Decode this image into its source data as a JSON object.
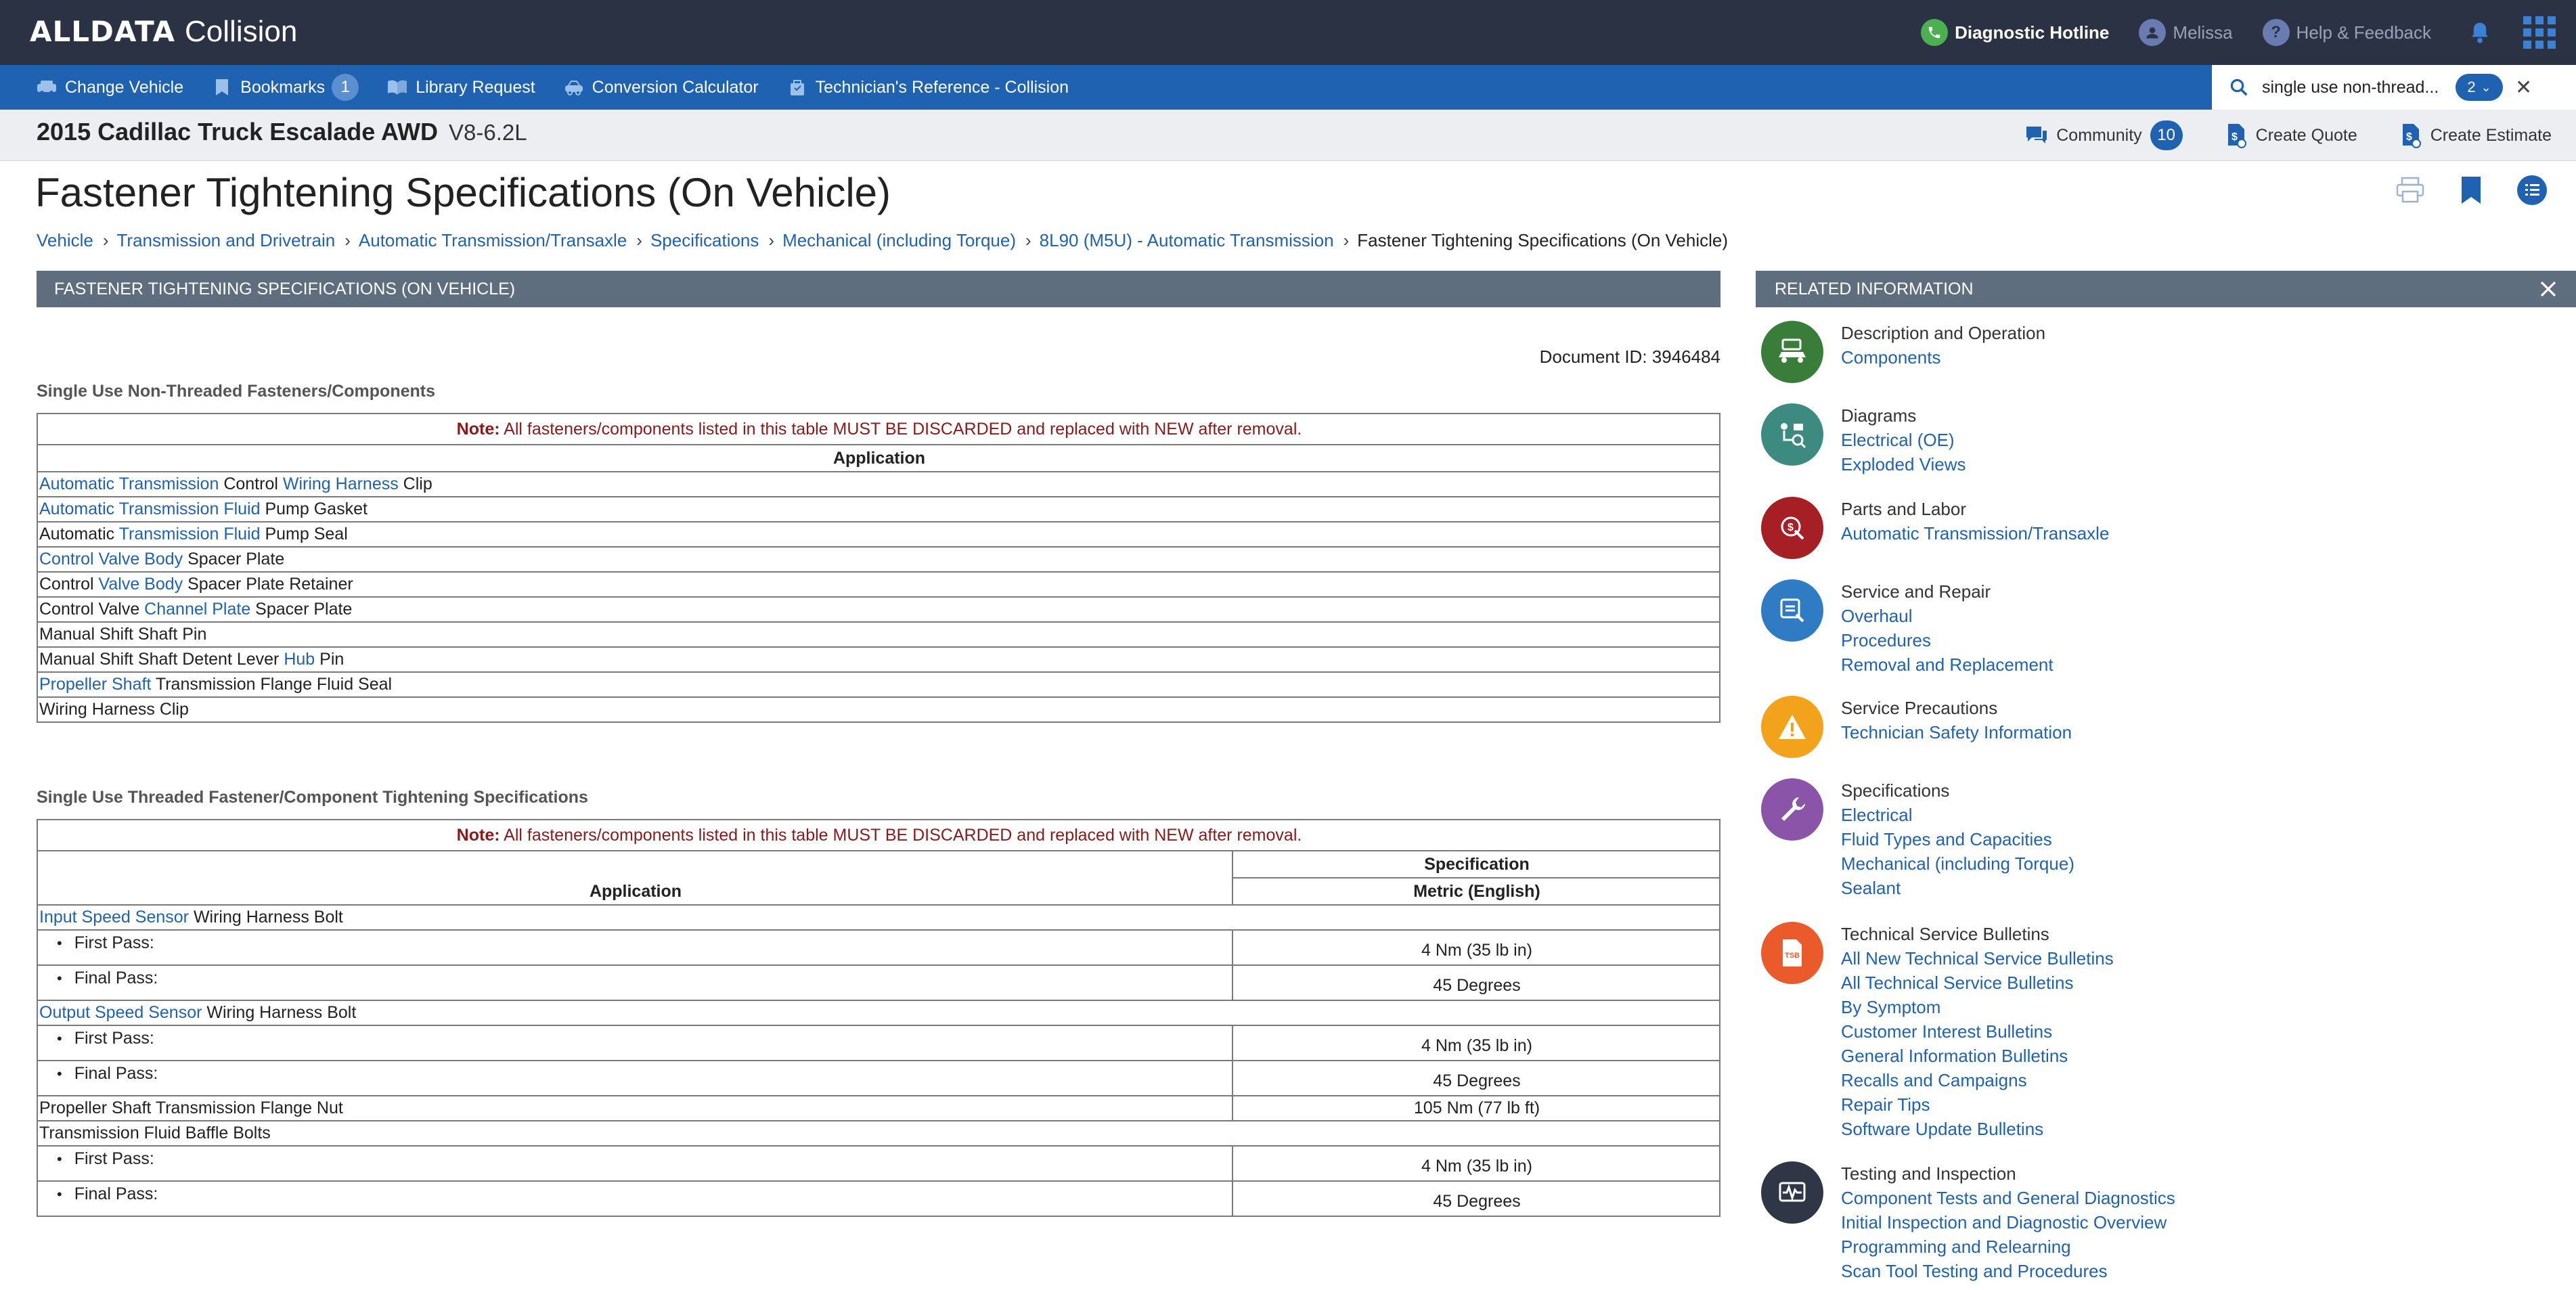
{
  "header": {
    "brand": "ALLDATA",
    "product": "Collision",
    "hotline_label": "Diagnostic Hotline",
    "user_name": "Melissa",
    "help_label": "Help & Feedback"
  },
  "nav": {
    "items": [
      {
        "label": "Change Vehicle",
        "icon": "car-icon"
      },
      {
        "label": "Bookmarks",
        "icon": "bookmark-icon",
        "badge": "1"
      },
      {
        "label": "Library Request",
        "icon": "book-icon"
      },
      {
        "label": "Conversion Calculator",
        "icon": "calculator-icon"
      },
      {
        "label": "Technician's Reference - Collision",
        "icon": "reference-icon"
      }
    ],
    "search": {
      "value": "single use non-thread...",
      "hit_count": "2"
    }
  },
  "vehicle": {
    "name": "2015 Cadillac Truck Escalade AWD",
    "engine": "V8-6.2L",
    "community_label": "Community",
    "community_count": "10",
    "quote_label": "Create Quote",
    "estimate_label": "Create Estimate"
  },
  "page": {
    "title": "Fastener Tightening Specifications (On Vehicle)",
    "breadcrumb": [
      "Vehicle",
      "Transmission and Drivetrain",
      "Automatic Transmission/Transaxle",
      "Specifications",
      "Mechanical (including Torque)",
      "8L90 (M5U) - Automatic Transmission",
      "Fastener Tightening Specifications (On Vehicle)"
    ]
  },
  "document": {
    "header": "FASTENER TIGHTENING SPECIFICATIONS (ON VEHICLE)",
    "doc_id": "Document ID: 3946484",
    "note_label": "Note:",
    "note_text": "All fasteners/components listed in this table MUST BE DISCARDED and replaced with NEW after removal.",
    "table1": {
      "title": "Single Use Non-Threaded Fasteners/Components",
      "column": "Application",
      "rows": [
        [
          {
            "t": "Automatic Transmission",
            "link": true
          },
          {
            "t": " Control "
          },
          {
            "t": "Wiring Harness",
            "link": true
          },
          {
            "t": " Clip"
          }
        ],
        [
          {
            "t": "Automatic Transmission Fluid",
            "link": true
          },
          {
            "t": " Pump Gasket"
          }
        ],
        [
          {
            "t": "Automatic "
          },
          {
            "t": "Transmission Fluid",
            "link": true
          },
          {
            "t": " Pump Seal"
          }
        ],
        [
          {
            "t": "Control Valve Body",
            "link": true
          },
          {
            "t": " Spacer Plate"
          }
        ],
        [
          {
            "t": "Control "
          },
          {
            "t": "Valve Body",
            "link": true
          },
          {
            "t": " Spacer Plate Retainer"
          }
        ],
        [
          {
            "t": "Control Valve "
          },
          {
            "t": "Channel Plate",
            "link": true
          },
          {
            "t": " Spacer Plate"
          }
        ],
        [
          {
            "t": "Manual Shift Shaft Pin"
          }
        ],
        [
          {
            "t": "Manual Shift Shaft Detent Lever "
          },
          {
            "t": "Hub",
            "link": true
          },
          {
            "t": " Pin"
          }
        ],
        [
          {
            "t": "Propeller Shaft",
            "link": true
          },
          {
            "t": " Transmission Flange Fluid Seal"
          }
        ],
        [
          {
            "t": "Wiring Harness Clip"
          }
        ]
      ]
    },
    "table2": {
      "title": "Single Use Threaded Fastener/Component Tightening Specifications",
      "col_application": "Application",
      "col_specification": "Specification",
      "col_units": "Metric (English)",
      "rows": [
        {
          "kind": "group",
          "parts": [
            {
              "t": "Input Speed Sensor",
              "link": true
            },
            {
              "t": " Wiring Harness Bolt"
            }
          ]
        },
        {
          "kind": "pass",
          "label": "First Pass:",
          "value": "4 Nm (35 lb in)"
        },
        {
          "kind": "pass",
          "label": "Final Pass:",
          "value": "45 Degrees"
        },
        {
          "kind": "group",
          "parts": [
            {
              "t": "Output Speed Sensor",
              "link": true
            },
            {
              "t": " Wiring Harness Bolt"
            }
          ]
        },
        {
          "kind": "pass",
          "label": "First Pass:",
          "value": "4 Nm (35 lb in)"
        },
        {
          "kind": "pass",
          "label": "Final Pass:",
          "value": "45 Degrees"
        },
        {
          "kind": "single",
          "parts": [
            {
              "t": "Propeller Shaft Transmission Flange Nut"
            }
          ],
          "value": "105 Nm (77 lb ft)"
        },
        {
          "kind": "group",
          "parts": [
            {
              "t": "Transmission Fluid Baffle Bolts"
            }
          ]
        },
        {
          "kind": "pass",
          "label": "First Pass:",
          "value": "4 Nm (35 lb in)"
        },
        {
          "kind": "pass",
          "label": "Final Pass:",
          "value": "45 Degrees"
        }
      ]
    }
  },
  "related": {
    "header": "RELATED INFORMATION",
    "groups": [
      {
        "category": "Description and Operation",
        "icon": "description-icon",
        "color": "#3a7d3a",
        "links": [
          "Components"
        ]
      },
      {
        "category": "Diagrams",
        "icon": "diagram-icon",
        "color": "#3d8a80",
        "links": [
          "Electrical (OE)",
          "Exploded Views"
        ]
      },
      {
        "category": "Parts and Labor",
        "icon": "parts-labor-icon",
        "color": "#a51f24",
        "links": [
          "Automatic Transmission/Transaxle"
        ]
      },
      {
        "category": "Service and Repair",
        "icon": "service-repair-icon",
        "color": "#2f7cc4",
        "links": [
          "Overhaul",
          "Procedures",
          "Removal and Replacement"
        ]
      },
      {
        "category": "Service Precautions",
        "icon": "warning-icon",
        "color": "#f2a31b",
        "links": [
          "Technician Safety Information"
        ]
      },
      {
        "category": "Specifications",
        "icon": "wrench-icon",
        "color": "#8a55a8",
        "links": [
          "Electrical",
          "Fluid Types and Capacities",
          "Mechanical (including Torque)",
          "Sealant"
        ]
      },
      {
        "category": "Technical Service Bulletins",
        "icon": "tsb-icon",
        "color": "#ea5a2b",
        "links": [
          "All New Technical Service Bulletins",
          "All Technical Service Bulletins",
          "By Symptom",
          "Customer Interest Bulletins",
          "General Information Bulletins",
          "Recalls and Campaigns",
          "Repair Tips",
          "Software Update Bulletins"
        ]
      },
      {
        "category": "Testing and Inspection",
        "icon": "testing-icon",
        "color": "#2f3645",
        "links": [
          "Component Tests and General Diagnostics",
          "Initial Inspection and Diagnostic Overview",
          "Programming and Relearning",
          "Scan Tool Testing and Procedures"
        ]
      }
    ]
  },
  "colors": {
    "topbar": "#2a3243",
    "navbar": "#1f62b1",
    "link": "#1f62b1",
    "note": "#8b1a1a",
    "section_header": "#5f6e7f"
  }
}
